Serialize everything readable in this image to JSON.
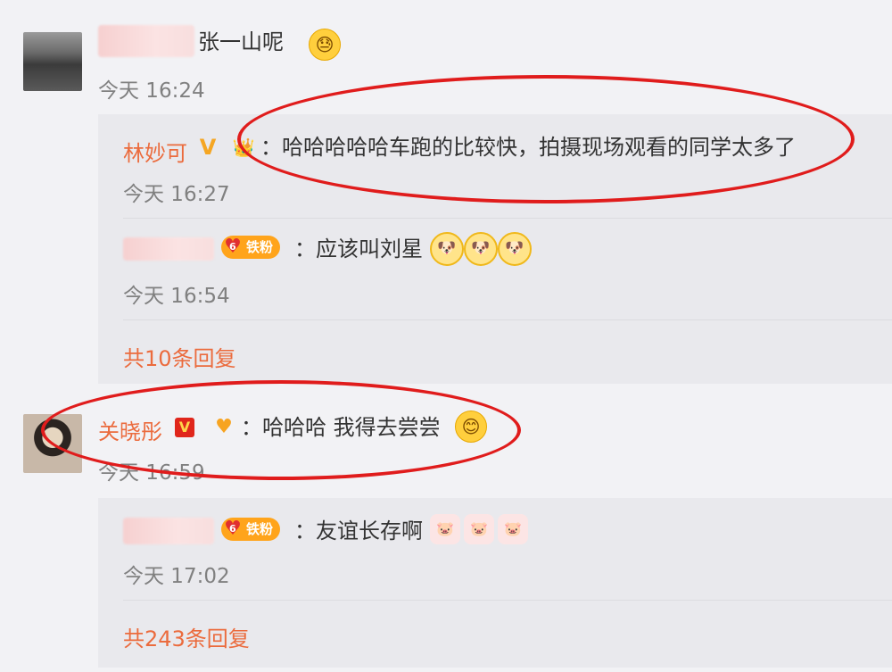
{
  "comment1": {
    "text": "张一山呢",
    "emoji": "😓",
    "time": "今天 16:24"
  },
  "reply_group1": {
    "reply1": {
      "name": "林妙可",
      "verified_mark": "V",
      "text": "：哈哈哈哈哈车跑的比较快，拍摄现场观看的同学太多了",
      "time": "今天 16:27"
    },
    "reply2": {
      "fan_badge": "铁粉",
      "fan_level": "6",
      "text": "：应该叫刘星",
      "emojis": [
        "🐶",
        "🐶",
        "🐶"
      ],
      "time": "今天 16:54"
    },
    "more": "共10条回复"
  },
  "comment2": {
    "name": "关晓彤",
    "verified_mark": "V",
    "text": "：哈哈哈 我得去尝尝",
    "emoji": "😊",
    "time": "今天 16:59"
  },
  "reply_group2": {
    "reply1": {
      "fan_badge": "铁粉",
      "fan_level": "6",
      "text": "：友谊长存啊",
      "emojis": [
        "🐷",
        "🐷",
        "🐷"
      ],
      "time": "今天 17:02"
    },
    "more": "共243条回复"
  },
  "colors": {
    "name_accent": "#eb6b3d",
    "annotation_red": "#e01c1c",
    "background": "#f2f2f5",
    "reply_panel": "#e9e9ed"
  }
}
